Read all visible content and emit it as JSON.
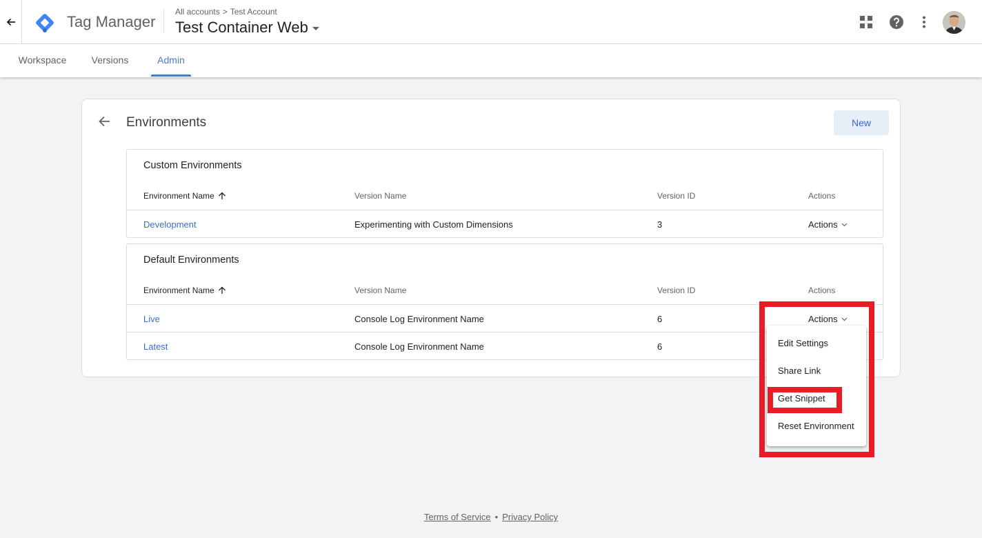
{
  "header": {
    "product_name": "Tag Manager",
    "breadcrumb_account_link": "All accounts",
    "breadcrumb_separator": ">",
    "breadcrumb_account": "Test Account",
    "container_name": "Test Container Web",
    "icons": [
      "back-arrow-icon",
      "apps-grid-icon",
      "help-icon",
      "more-vert-icon",
      "avatar"
    ]
  },
  "tabs": [
    {
      "label": "Workspace"
    },
    {
      "label": "Versions"
    },
    {
      "label": "Admin",
      "active": true
    }
  ],
  "page": {
    "title": "Environments",
    "new_button": "New"
  },
  "custom_environments": {
    "title": "Custom Environments",
    "columns": [
      "Environment Name",
      "Version Name",
      "Version ID",
      "Actions"
    ],
    "rows": [
      {
        "name": "Development",
        "version_name": "Experimenting with Custom Dimensions",
        "version_id": "3",
        "actions": "Actions"
      }
    ]
  },
  "default_environments": {
    "title": "Default Environments",
    "columns": [
      "Environment Name",
      "Version Name",
      "Version ID",
      "Actions"
    ],
    "rows": [
      {
        "name": "Live",
        "version_name": "Console Log Environment Name",
        "version_id": "6",
        "actions": "Actions"
      },
      {
        "name": "Latest",
        "version_name": "Console Log Environment Name",
        "version_id": "6",
        "actions": ""
      }
    ]
  },
  "actions_menu": {
    "items": [
      "Edit Settings",
      "Share Link",
      "Get Snippet",
      "Reset Environment"
    ],
    "highlighted": "Get Snippet"
  },
  "footer": {
    "terms": "Terms of Service",
    "separator": "•",
    "privacy": "Privacy Policy"
  },
  "colors": {
    "accent": "#4a7bc4",
    "link": "#3b6ec4",
    "highlight_box": "#e81c24",
    "logo_blue": "#4285f4",
    "logo_dark": "#246fdb"
  }
}
